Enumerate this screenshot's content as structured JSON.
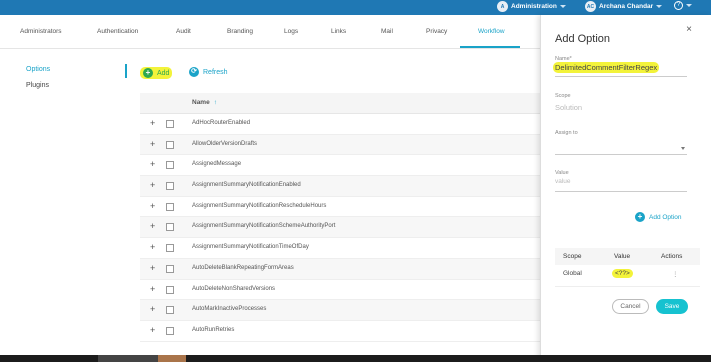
{
  "colors": {
    "brand": "#1f78b4",
    "accent": "#1aa3c8",
    "save": "#16c2d0",
    "highlight": "#f3f33a"
  },
  "header": {
    "users": [
      {
        "initials": "A",
        "name": "Administration"
      },
      {
        "initials": "AC",
        "name": "Archana Chandar"
      }
    ],
    "help_icon": "help-icon"
  },
  "tabs": [
    "Administrators",
    "Authentication",
    "Audit",
    "Branding",
    "Logs",
    "Links",
    "Mail",
    "Privacy",
    "Workflow"
  ],
  "active_tab": "Workflow",
  "sidebar": {
    "items": [
      "Options",
      "Plugins"
    ],
    "active": "Options"
  },
  "toolbar": {
    "add_label": "Add",
    "refresh_label": "Refresh"
  },
  "grid": {
    "column": "Name",
    "sort": "↑",
    "rows": [
      "AdHocRouterEnabled",
      "AllowOlderVersionDrafts",
      "AssignedMessage",
      "AssignmentSummaryNotificationEnabled",
      "AssignmentSummaryNotificationRescheduleHours",
      "AssignmentSummaryNotificationSchemeAuthorityPort",
      "AssignmentSummaryNotificationTimeOfDay",
      "AutoDeleteBlankRepeatingFormAreas",
      "AutoDeleteNonSharedVersions",
      "AutoMarkInactiveProcesses",
      "AutoRunRetries"
    ]
  },
  "panel": {
    "title": "Add Option",
    "close": "×",
    "name_label": "Name*",
    "name_value": "DelimitedCommentFilterRegex",
    "scope_label": "Scope",
    "scope_value": "Solution",
    "assign_label": "Assign to",
    "value_label": "Value",
    "value_placeholder": "value",
    "add_option_label": "Add Option",
    "table": {
      "headers": [
        "Scope",
        "Value",
        "Actions"
      ],
      "rows": [
        {
          "scope": "Global",
          "value": "<??>",
          "actions": "⋮"
        }
      ]
    },
    "cancel_label": "Cancel",
    "save_label": "Save"
  }
}
